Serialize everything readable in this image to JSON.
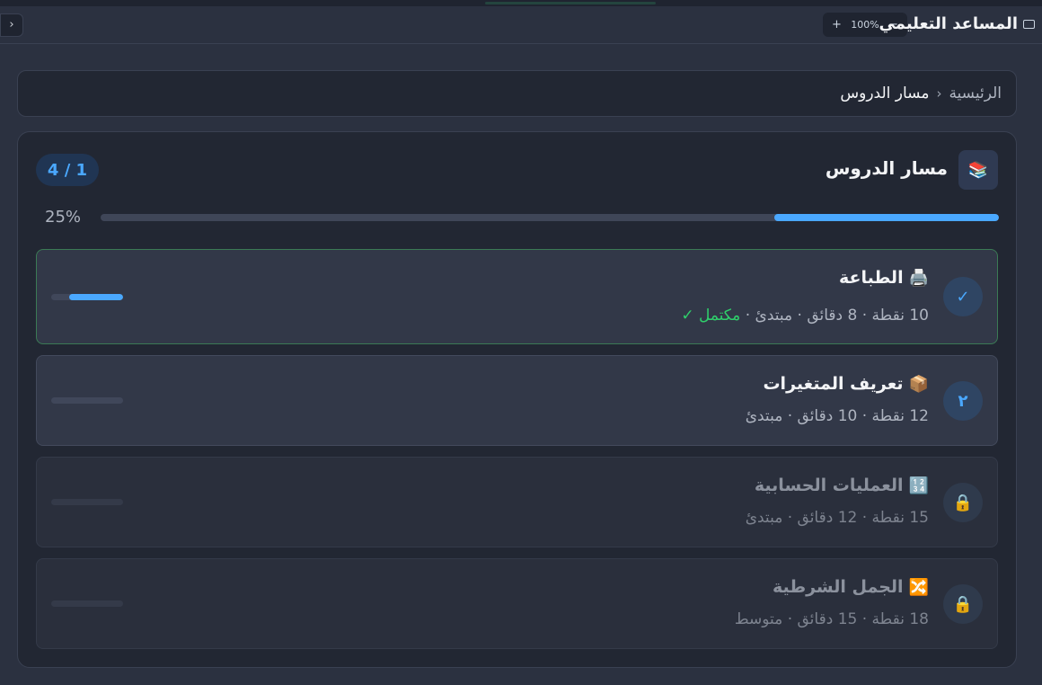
{
  "app": {
    "title": "المساعد التعليمي",
    "zoom_in": "+",
    "zoom_level": "100%",
    "zoom_out": "−",
    "collapse": "›"
  },
  "breadcrumb": {
    "home": "الرئيسية",
    "separator": "‹",
    "current": "مسار الدروس"
  },
  "course": {
    "title": "مسار الدروس",
    "icon": "📚",
    "counter": "4 / 1",
    "progress_label": "25%",
    "progress": 0.25
  },
  "lessons": [
    {
      "status": "done",
      "badge": "✓",
      "icon": "🖨️",
      "title": "الطباعة",
      "meta": "10 نقطة · 8 دقائق · مبتدئ ·",
      "done_label": "مكتمل ✓",
      "progress": 0.75
    },
    {
      "status": "current",
      "badge": "٢",
      "icon": "📦",
      "title": "تعريف المتغيرات",
      "meta": "12 نقطة · 10 دقائق · مبتدئ",
      "progress": 0
    },
    {
      "status": "locked",
      "badge": "🔒",
      "icon": "🔢",
      "title": "العمليات الحسابية",
      "meta": "15 نقطة · 12 دقائق · مبتدئ",
      "progress": 0
    },
    {
      "status": "locked",
      "badge": "🔒",
      "icon": "🔀",
      "title": "الجمل الشرطية",
      "meta": "18 نقطة · 15 دقائق · متوسط",
      "progress": 0
    }
  ],
  "colors": {
    "accent": "#4aa8ff",
    "done": "#2fcf6b",
    "background": "#2b3140",
    "card": "#222733"
  }
}
